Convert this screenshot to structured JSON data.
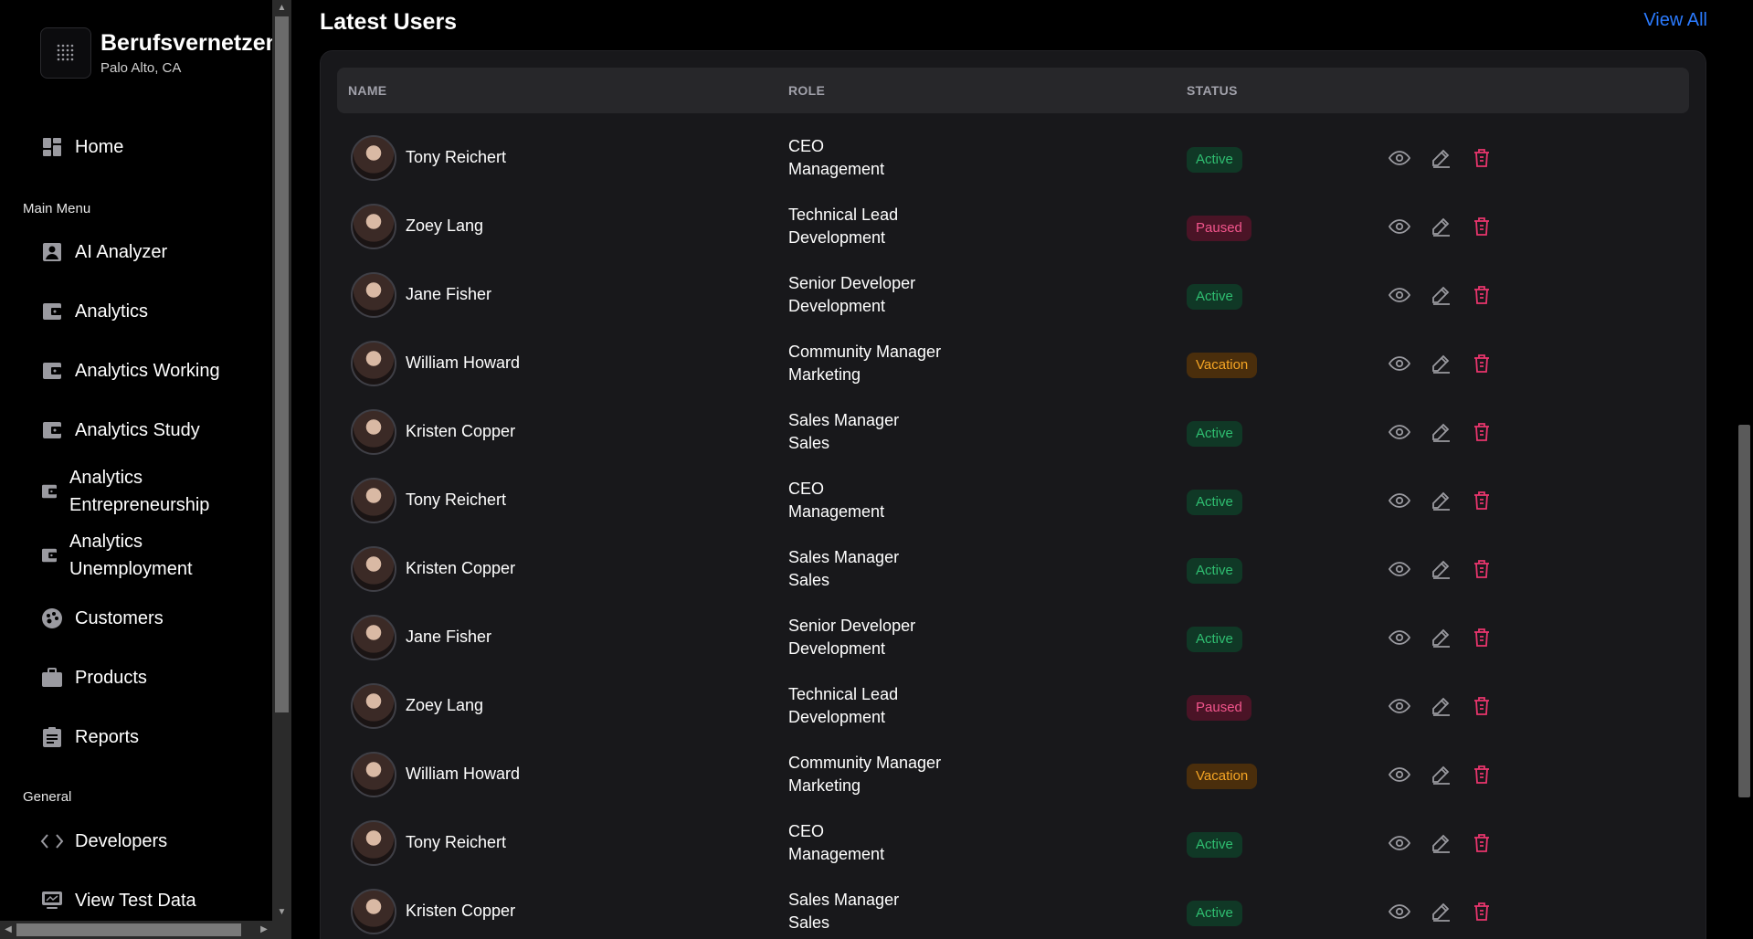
{
  "brand": {
    "title": "Berufsvernetzen",
    "subtitle": "Palo Alto, CA",
    "logo_icon": "dots-grid-icon"
  },
  "sidebar": {
    "home": {
      "label": "Home",
      "icon": "dashboard-icon"
    },
    "main_menu_label": "Main Menu",
    "items": [
      {
        "label": "AI Analyzer",
        "icon": "person-card-icon"
      },
      {
        "label": "Analytics",
        "icon": "wallet-icon"
      },
      {
        "label": "Analytics Working",
        "icon": "wallet-icon"
      },
      {
        "label": "Analytics Study",
        "icon": "wallet-icon"
      },
      {
        "label": "Analytics Entrepreneurship",
        "line1": "Analytics",
        "line2": "Entrepreneurship",
        "icon": "wallet-icon"
      },
      {
        "label": "Analytics Unemployment",
        "line1": "Analytics",
        "line2": "Unemployment",
        "icon": "wallet-icon"
      },
      {
        "label": "Customers",
        "icon": "palette-icon"
      },
      {
        "label": "Products",
        "icon": "briefcase-icon"
      },
      {
        "label": "Reports",
        "icon": "clipboard-icon"
      }
    ],
    "general_label": "General",
    "general_items": [
      {
        "label": "Developers",
        "icon": "code-icon"
      },
      {
        "label": "View Test Data",
        "icon": "monitor-icon"
      }
    ]
  },
  "main": {
    "title": "Latest Users",
    "view_all": "View All",
    "columns": [
      "NAME",
      "ROLE",
      "STATUS"
    ],
    "rows": [
      {
        "name": "Tony Reichert",
        "role": "CEO",
        "team": "Management",
        "status": "Active"
      },
      {
        "name": "Zoey Lang",
        "role": "Technical Lead",
        "team": "Development",
        "status": "Paused"
      },
      {
        "name": "Jane Fisher",
        "role": "Senior Developer",
        "team": "Development",
        "status": "Active"
      },
      {
        "name": "William Howard",
        "role": "Community Manager",
        "team": "Marketing",
        "status": "Vacation"
      },
      {
        "name": "Kristen Copper",
        "role": "Sales Manager",
        "team": "Sales",
        "status": "Active"
      },
      {
        "name": "Tony Reichert",
        "role": "CEO",
        "team": "Management",
        "status": "Active"
      },
      {
        "name": "Kristen Copper",
        "role": "Sales Manager",
        "team": "Sales",
        "status": "Active"
      },
      {
        "name": "Jane Fisher",
        "role": "Senior Developer",
        "team": "Development",
        "status": "Active"
      },
      {
        "name": "Zoey Lang",
        "role": "Technical Lead",
        "team": "Development",
        "status": "Paused"
      },
      {
        "name": "William Howard",
        "role": "Community Manager",
        "team": "Marketing",
        "status": "Vacation"
      },
      {
        "name": "Tony Reichert",
        "role": "CEO",
        "team": "Management",
        "status": "Active"
      },
      {
        "name": "Kristen Copper",
        "role": "Sales Manager",
        "team": "Sales",
        "status": "Active"
      }
    ]
  },
  "colors": {
    "accent_link": "#2b7bff",
    "active": "#2fbf71",
    "paused": "#f2558c",
    "vacation": "#f5a524",
    "delete_icon": "#e8356d"
  }
}
